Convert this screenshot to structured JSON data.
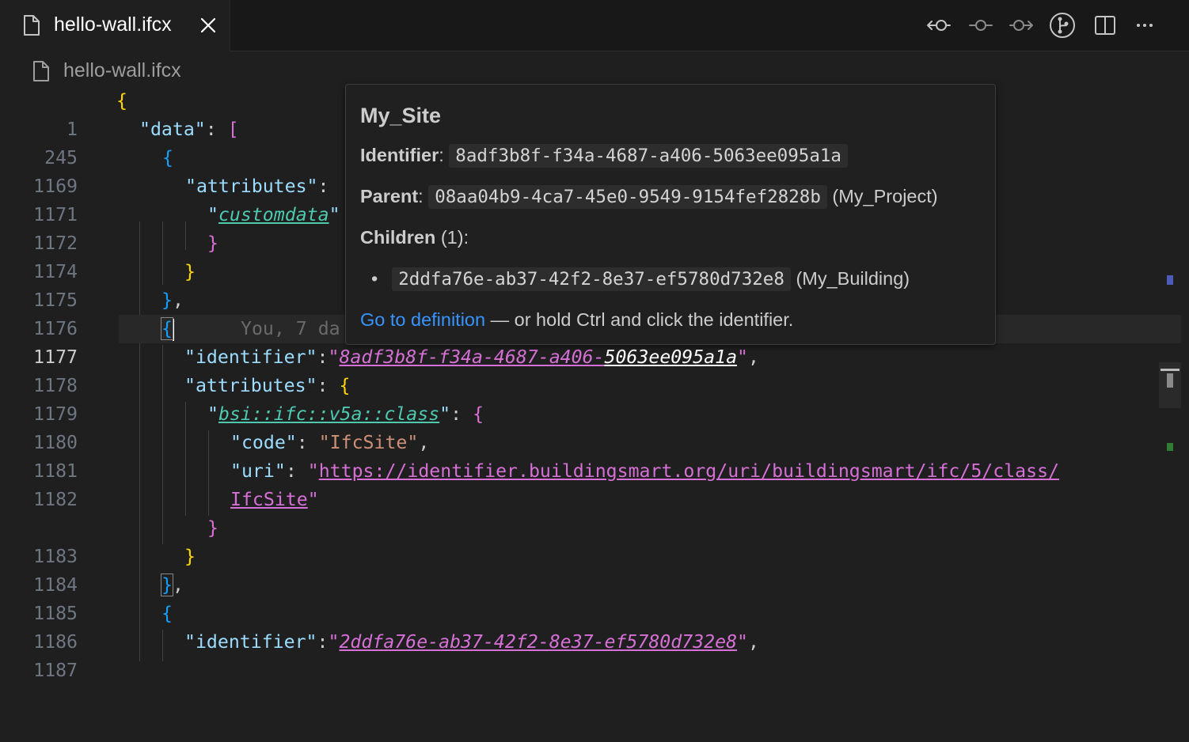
{
  "tab": {
    "label": "hello-wall.ifcx",
    "close_icon": "close-icon",
    "file_icon": "file-icon"
  },
  "actions": [
    {
      "name": "go-back-icon"
    },
    {
      "name": "commit-icon"
    },
    {
      "name": "go-forward-icon"
    },
    {
      "name": "source-control-icon"
    },
    {
      "name": "split-editor-icon"
    },
    {
      "name": "more-actions-icon"
    }
  ],
  "breadcrumb": {
    "label": "hello-wall.ifcx"
  },
  "editor": {
    "line_numbers": [
      "1",
      "245",
      "1169",
      "1171",
      "1172",
      "1174",
      "1175",
      "1176",
      "1177",
      "1178",
      "1179",
      "1180",
      "1181",
      "1182",
      "1183",
      "1184",
      "1185",
      "1186",
      "1187"
    ],
    "blame": "You, 7 da",
    "lines": {
      "l1_open": "{",
      "l245_key": "\"data\"",
      "l245_colon": ": ",
      "l245_bracket": "[",
      "l1169_brace": "{",
      "l1171_key": "\"attributes\"",
      "l1171_colon": ":",
      "l1172_q1": "\"",
      "l1172_key": "customdata",
      "l1172_q2": "\"",
      "l1174_brace": "}",
      "l1175_brace": "}",
      "l1176_brace": "}",
      "l1176_comma": ",",
      "l1177_brace": "{",
      "l1178_key": "\"identifier\"",
      "l1178_colon": ":",
      "l1178_q1": "\"",
      "l1178_val": "8adf3b8f-f34a-4687-a406-",
      "l1178_val2": "5063ee095a1a",
      "l1178_q2": "\"",
      "l1178_comma": ",",
      "l1179_key": "\"attributes\"",
      "l1179_colon": ": ",
      "l1179_brace": "{",
      "l1180_q1": "\"",
      "l1180_key": "bsi::ifc::v5a::class",
      "l1180_q2": "\"",
      "l1180_colon": ": ",
      "l1180_brace": "{",
      "l1181_key": "\"code\"",
      "l1181_colon": ": ",
      "l1181_val": "\"IfcSite\"",
      "l1181_comma": ",",
      "l1182_key": "\"uri\"",
      "l1182_colon": ": ",
      "l1182_q1": "\"",
      "l1182_val": "https://identifier.buildingsmart.org/uri/buildingsmart/ifc/5/class/",
      "l1182b_val": "IfcSite",
      "l1182b_q2": "\"",
      "l1183_brace": "}",
      "l1184_brace": "}",
      "l1185_brace": "}",
      "l1185_comma": ",",
      "l1186_brace": "{",
      "l1187_key": "\"identifier\"",
      "l1187_colon": ":",
      "l1187_q1": "\"",
      "l1187_val": "2ddfa76e-ab37-42f2-8e37-ef5780d732e8",
      "l1187_q2": "\"",
      "l1187_comma": ","
    }
  },
  "hover": {
    "title": "My_Site",
    "identifier_label": "Identifier",
    "identifier_sep": ":",
    "identifier_value": "8adf3b8f-f34a-4687-a406-5063ee095a1a",
    "parent_label": "Parent",
    "parent_sep": ":",
    "parent_value": "08aa04b9-4ca7-45e0-9549-9154fef2828b",
    "parent_name": "(My_Project)",
    "children_label": "Children",
    "children_count": "(1):",
    "children": [
      {
        "id": "2ddfa76e-ab37-42f2-8e37-ef5780d732e8",
        "name": "(My_Building)"
      }
    ],
    "goto_link": "Go to definition",
    "goto_hint": " — or hold Ctrl and click the identifier."
  },
  "colors": {
    "background": "#1f1f1f",
    "key": "#9cdcfe",
    "string": "#ce9178",
    "link": "#3794ff",
    "bracket_gold": "#ffd700",
    "bracket_purple": "#da70d6",
    "bracket_blue": "#179fff"
  }
}
